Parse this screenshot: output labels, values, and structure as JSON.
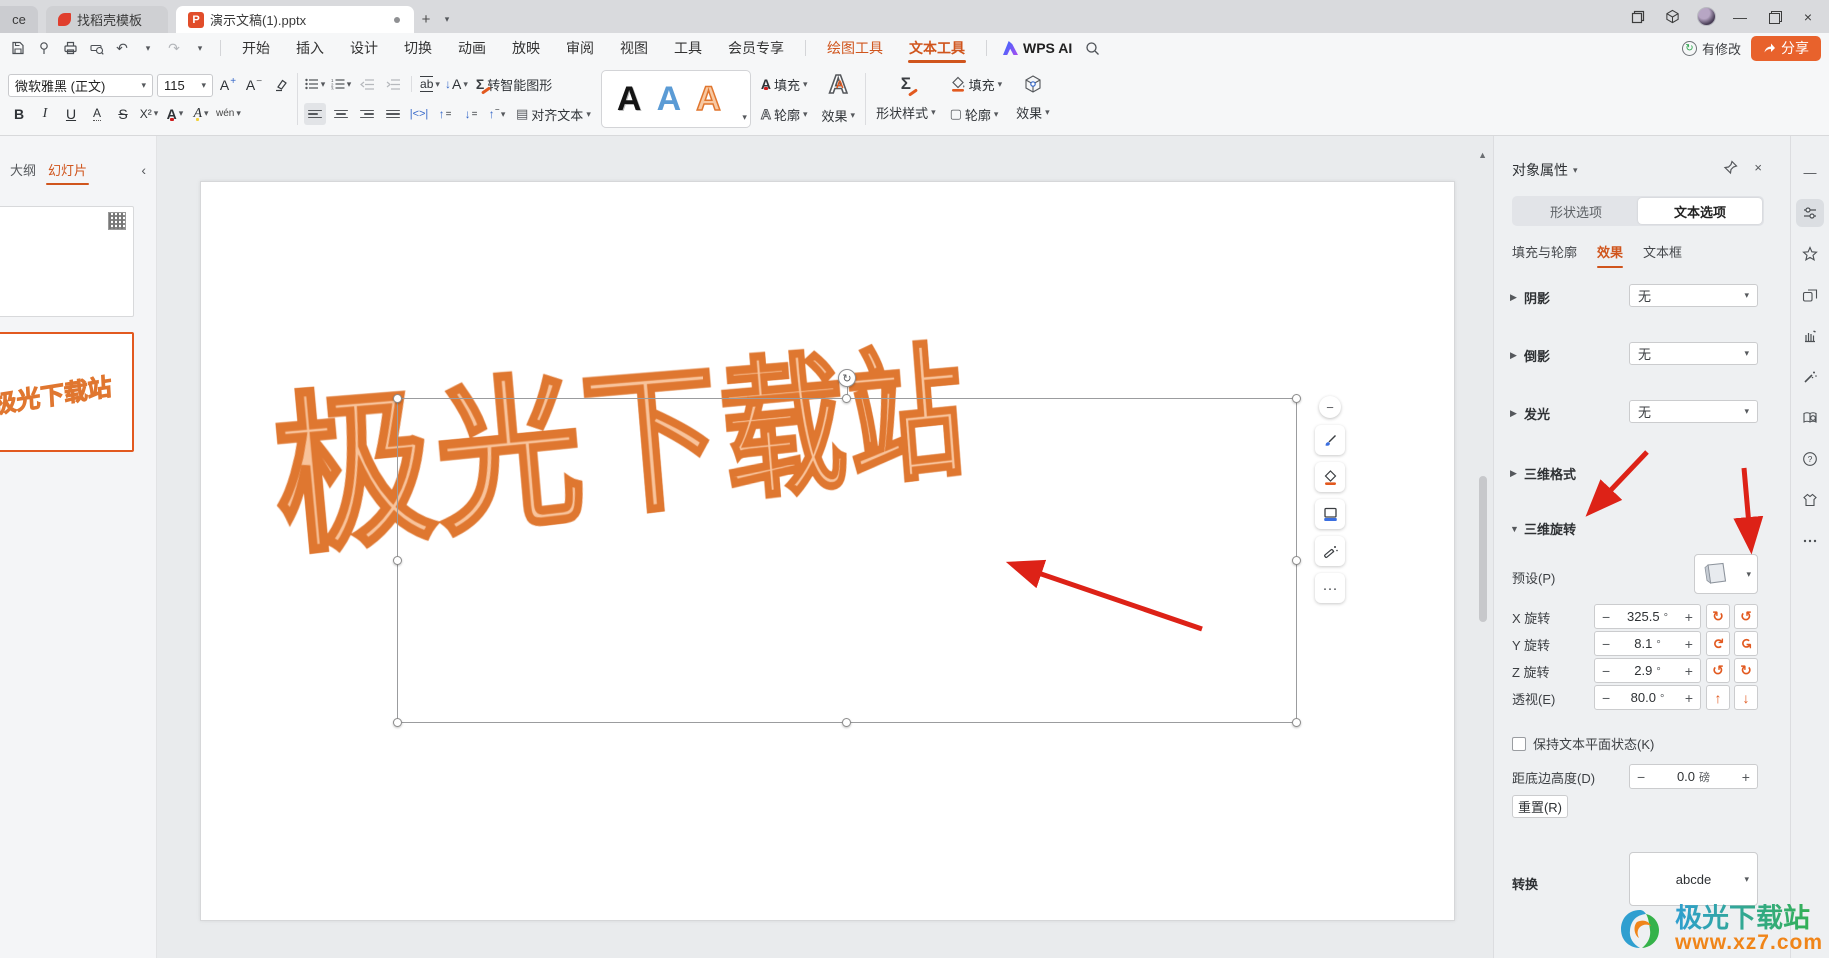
{
  "icons": {
    "plus": "+",
    "chevron_down": "▾",
    "collapse_left": "‹",
    "minimize": "—",
    "close": "×",
    "undo": "↶",
    "redo": "↷",
    "rotate_cw": "↻",
    "rotate_ccw": "↺",
    "arrow_up": "↑",
    "arrow_down": "↓",
    "expand_right": "▶",
    "expand_down": "▼",
    "dots_v": "⋯",
    "more_dots": "···",
    "minus": "−",
    "question": "?",
    "ppt": "P",
    "refresh": "↻"
  },
  "window": {
    "titlebar": {
      "overflow_tab": "ce",
      "docer_tab": "找稻壳模板",
      "document_tab": "演示文稿(1).pptx"
    },
    "modified_badge": "有修改",
    "share_button": "分享"
  },
  "menubar": {
    "items": [
      "开始",
      "插入",
      "设计",
      "切换",
      "动画",
      "放映",
      "审阅",
      "视图",
      "工具",
      "会员专享"
    ],
    "tool_tabs": [
      "绘图工具",
      "文本工具"
    ],
    "wps_ai": "WPS AI"
  },
  "ribbon": {
    "font_name": "微软雅黑 (正文)",
    "font_size": "115",
    "smart_graphic": "转智能图形",
    "align_text": "对齐文本",
    "text_fill": "填充",
    "text_outline": "轮廓",
    "text_effect": "效果",
    "shape_style": "形状样式",
    "shape_fill": "填充",
    "shape_outline": "轮廓",
    "shape_effect": "效果",
    "glyphs": {
      "grow_font": "A",
      "shrink_font": "A",
      "bold": "B",
      "italic": "I",
      "underline": "U",
      "char_border": "A",
      "strike": "S",
      "superscript": "X²",
      "font_color": "A",
      "highlight": "A",
      "phonetic": "wén",
      "text_direction": "ab",
      "char_spacing": "A",
      "sigma": "Σ",
      "wordart_black": "A",
      "wordart_blue": "A",
      "wordart_orange": "A",
      "outline_square": "▢",
      "align_text_box": "▤"
    }
  },
  "sidebar": {
    "outline_tab": "大纲",
    "slides_tab": "幻灯片",
    "thumb_wordart": "极光下载站"
  },
  "slide": {
    "wordart_text": "极光下载站"
  },
  "panel": {
    "title": "对象属性",
    "option_tabs": [
      "形状选项",
      "文本选项"
    ],
    "sub_tabs": [
      "填充与轮廓",
      "效果",
      "文本框"
    ],
    "effect_rows": [
      {
        "label": "阴影",
        "value": "无"
      },
      {
        "label": "倒影",
        "value": "无"
      },
      {
        "label": "发光",
        "value": "无"
      }
    ],
    "format3d": "三维格式",
    "rotate3d": "三维旋转",
    "preset": "预设(P)",
    "spin_rows": [
      {
        "label": "X 旋转",
        "value": "325.5",
        "unit": "°"
      },
      {
        "label": "Y 旋转",
        "value": "8.1",
        "unit": "°"
      },
      {
        "label": "Z 旋转",
        "value": "2.9",
        "unit": "°"
      },
      {
        "label": "透视(E)",
        "value": "80.0",
        "unit": "°"
      }
    ],
    "keep_flat": "保持文本平面状态(K)",
    "base_height_label": "距底边高度(D)",
    "base_height_value": "0.0",
    "base_height_unit": "磅",
    "reset": "重置(R)",
    "transform_label": "转换",
    "transform_value": "abcde",
    "minus": "−",
    "plus": "+"
  },
  "watermark": {
    "name": "极光下载站",
    "url": "www.xz7.com"
  },
  "colors": {
    "accent_orange": "#e2591f",
    "share_button": "#e8622c",
    "wordart_fill": "#f8c39b",
    "wordart_stroke": "#df7730",
    "annotation_red": "#dd2217",
    "watermark_green": "#35b24a",
    "watermark_blue": "#2f9fd0",
    "watermark_orange": "#f08519"
  }
}
